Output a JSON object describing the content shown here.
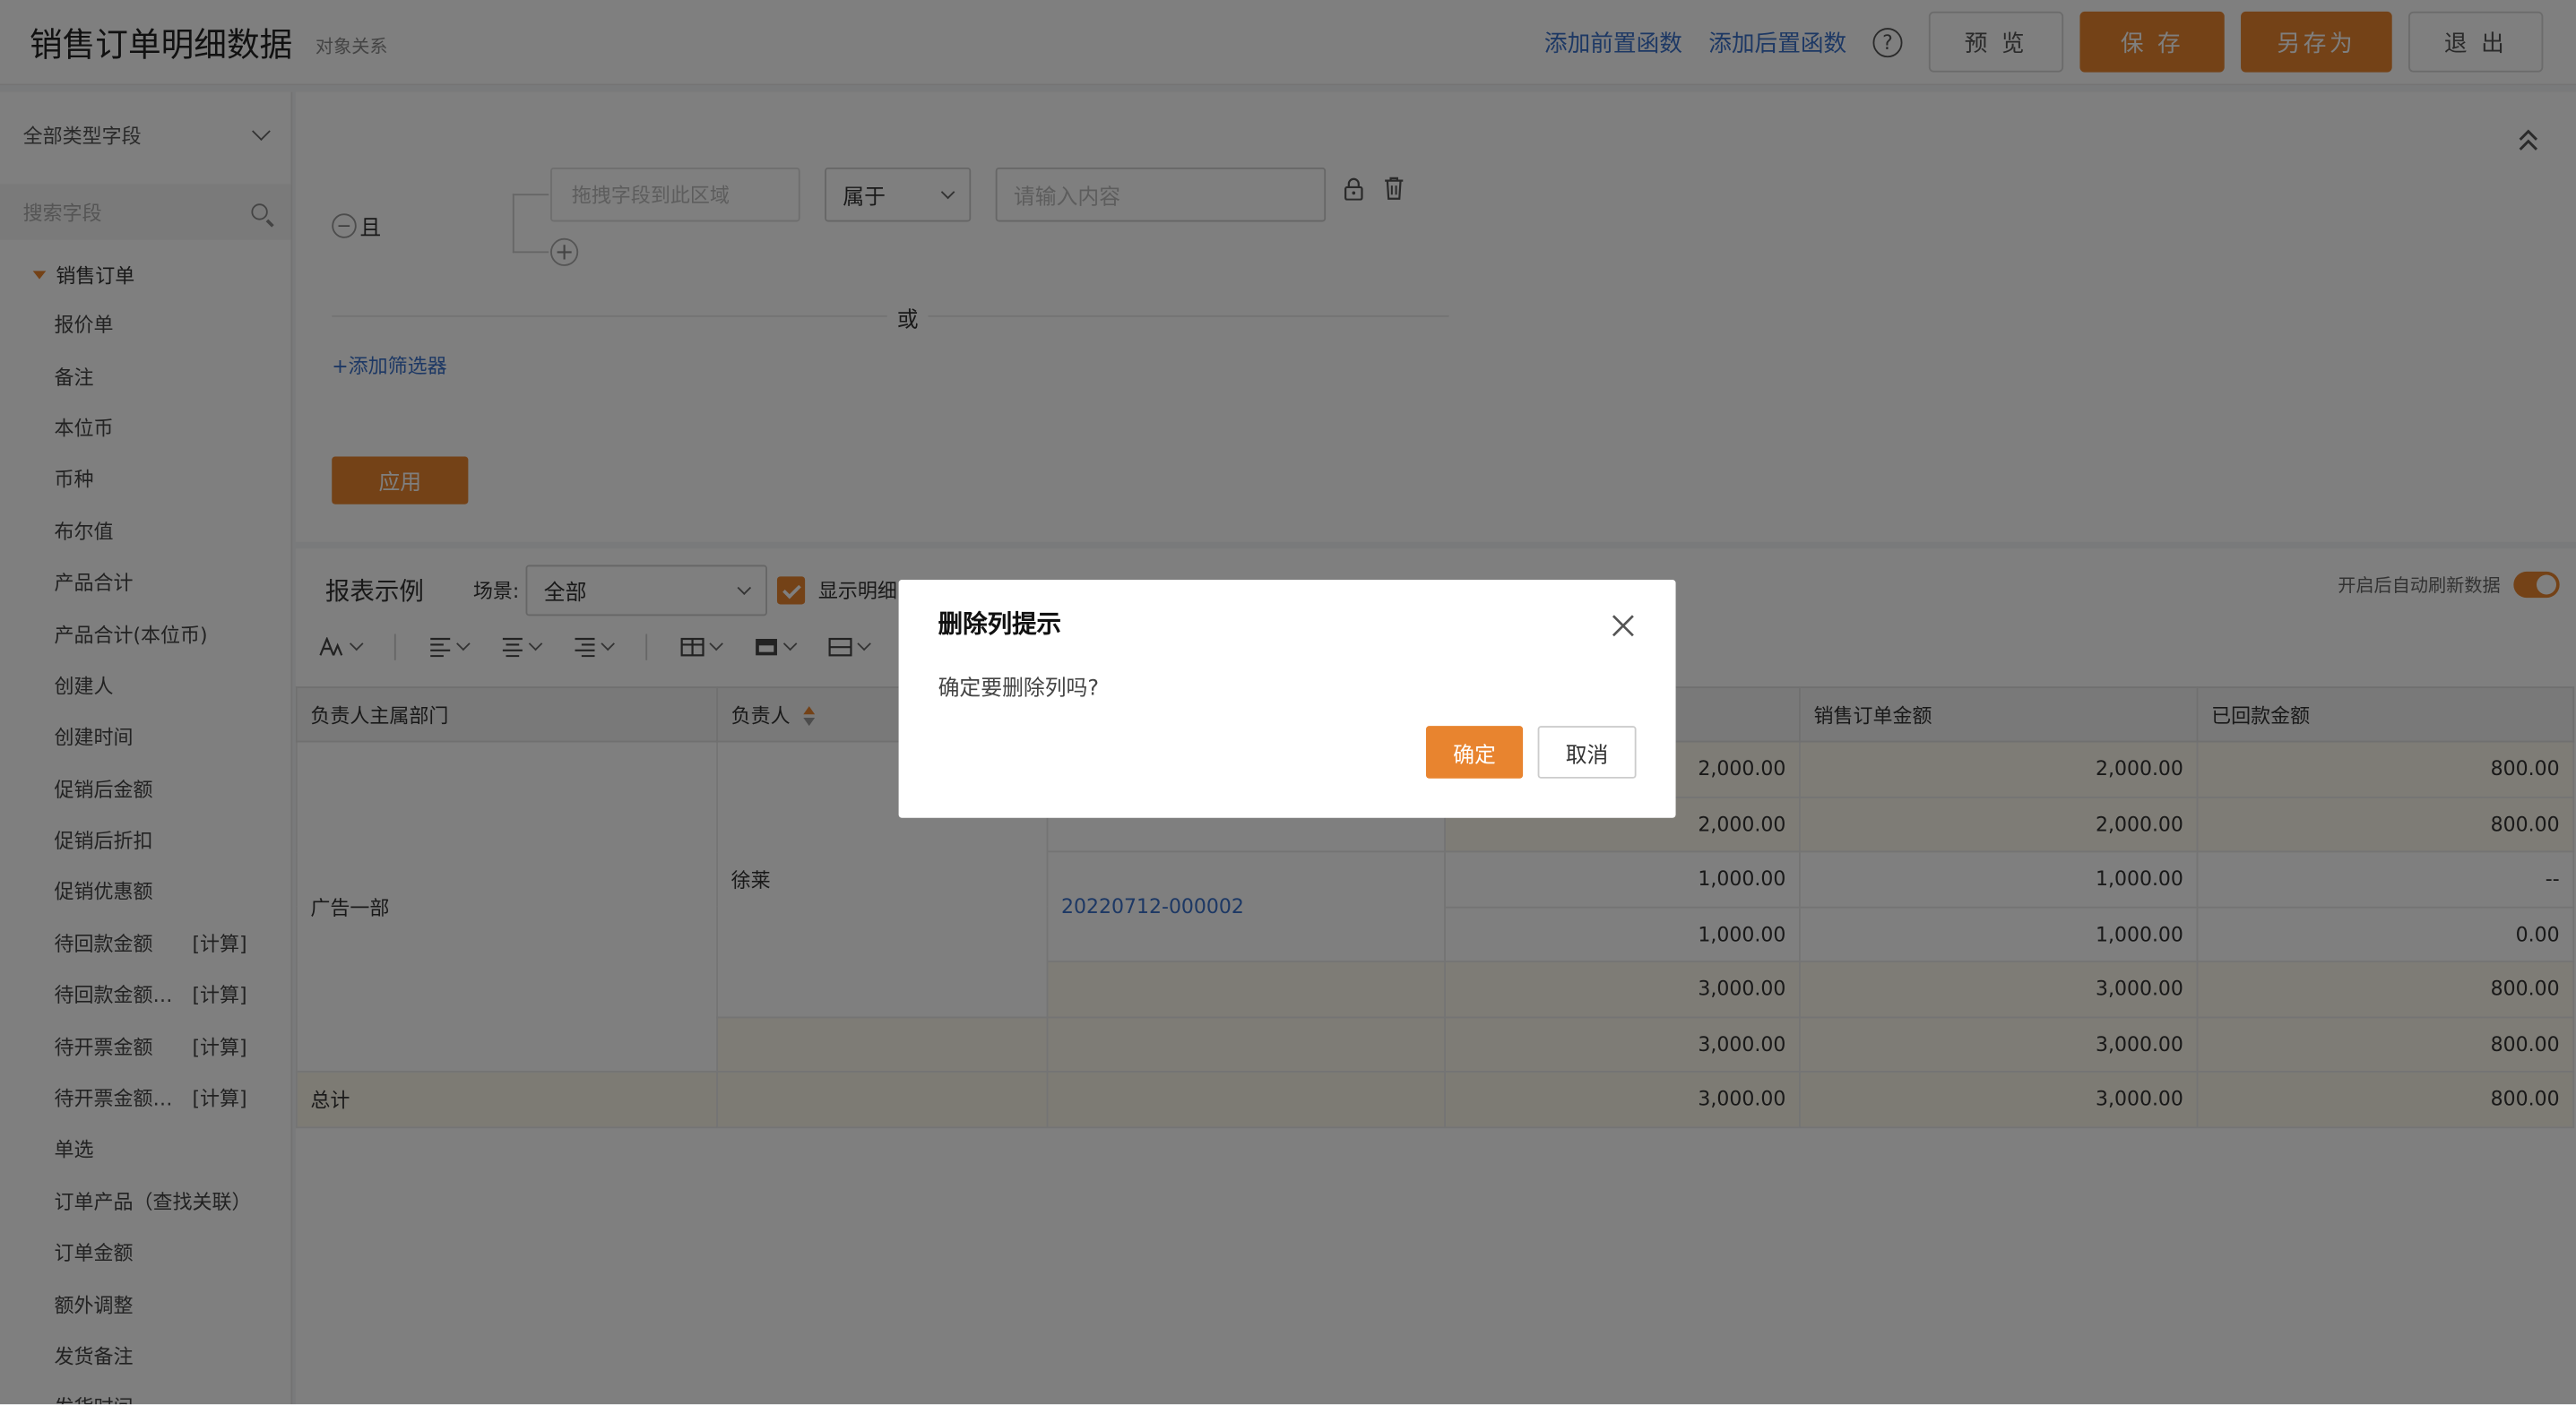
{
  "header": {
    "title": "销售订单明细数据",
    "subtitle": "对象关系",
    "add_pre_func": "添加前置函数",
    "add_post_func": "添加后置函数",
    "help_glyph": "?",
    "preview": "预 览",
    "save": "保 存",
    "save_as": "另存为",
    "exit": "退 出"
  },
  "sidebar": {
    "type_select": "全部类型字段",
    "search_placeholder": "搜索字段",
    "root": "销售订单",
    "items": [
      {
        "label": "报价单",
        "tag": ""
      },
      {
        "label": "备注",
        "tag": ""
      },
      {
        "label": "本位币",
        "tag": ""
      },
      {
        "label": "币种",
        "tag": ""
      },
      {
        "label": "布尔值",
        "tag": ""
      },
      {
        "label": "产品合计",
        "tag": ""
      },
      {
        "label": "产品合计(本位币)",
        "tag": ""
      },
      {
        "label": "创建人",
        "tag": ""
      },
      {
        "label": "创建时间",
        "tag": ""
      },
      {
        "label": "促销后金额",
        "tag": ""
      },
      {
        "label": "促销后折扣",
        "tag": ""
      },
      {
        "label": "促销优惠额",
        "tag": ""
      },
      {
        "label": "待回款金额",
        "tag": "[计算]"
      },
      {
        "label": "待回款金额…",
        "tag": "[计算]"
      },
      {
        "label": "待开票金额",
        "tag": "[计算]"
      },
      {
        "label": "待开票金额…",
        "tag": "[计算]"
      },
      {
        "label": "单选",
        "tag": ""
      },
      {
        "label": "订单产品（查找关联）",
        "tag": ""
      },
      {
        "label": "订单金额",
        "tag": ""
      },
      {
        "label": "额外调整",
        "tag": ""
      },
      {
        "label": "发货备注",
        "tag": ""
      },
      {
        "label": "发货时间",
        "tag": ""
      }
    ]
  },
  "filter": {
    "and_label": "且",
    "minus_glyph": "−",
    "plus_glyph": "+",
    "drop_placeholder": "拖拽字段到此区域",
    "operator": "属于",
    "value_placeholder": "请输入内容",
    "or_label": "或",
    "add_filter": "+添加筛选器",
    "apply": "应用"
  },
  "report": {
    "title": "报表示例",
    "scene_label": "场景:",
    "scene_value": "全部",
    "show_detail": "显示明细",
    "auto_refresh": "开启后自动刷新数据",
    "toolbar_icons": [
      "font-size-icon",
      "align-left-icon",
      "align-center-icon",
      "align-right-icon",
      "table-style-icon",
      "fill-icon",
      "border-icon",
      "layout-icon"
    ],
    "columns": [
      "负责人主属部门",
      "负责人",
      "",
      "",
      "销售订单金额",
      "已回款金额"
    ],
    "dept": "广告一部",
    "owner": "徐莱",
    "order_no": "20220712-000002",
    "rows": [
      {
        "c4": "2,000.00",
        "c5": "2,000.00",
        "c6": "800.00"
      },
      {
        "c4": "2,000.00",
        "c5": "2,000.00",
        "c6": "800.00"
      },
      {
        "c4": "1,000.00",
        "c5": "1,000.00",
        "c6": "--"
      },
      {
        "c4": "1,000.00",
        "c5": "1,000.00",
        "c6": "0.00"
      },
      {
        "c4": "3,000.00",
        "c5": "3,000.00",
        "c6": "800.00"
      },
      {
        "c4": "3,000.00",
        "c5": "3,000.00",
        "c6": "800.00"
      }
    ],
    "total_label": "总计",
    "total": {
      "c4": "3,000.00",
      "c5": "3,000.00",
      "c6": "800.00"
    }
  },
  "modal": {
    "title": "删除列提示",
    "body": "确定要删除列吗?",
    "ok": "确定",
    "cancel": "取消"
  },
  "colors": {
    "accent": "#e8842f",
    "link": "#3b71c9"
  }
}
